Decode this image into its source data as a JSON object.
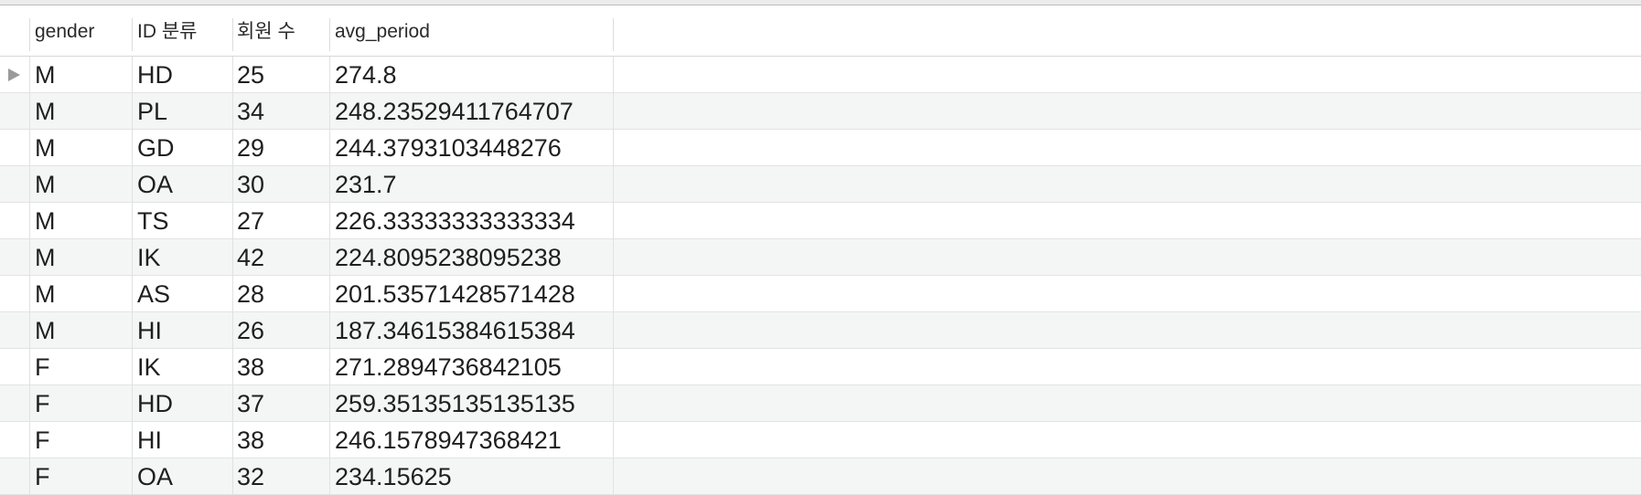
{
  "columns": {
    "gender": "gender",
    "id_category": "ID 분류",
    "member_count": "회원 수",
    "avg_period": "avg_period"
  },
  "rows": [
    {
      "gender": "M",
      "id_category": "HD",
      "member_count": "25",
      "avg_period": "274.8"
    },
    {
      "gender": "M",
      "id_category": "PL",
      "member_count": "34",
      "avg_period": "248.23529411764707"
    },
    {
      "gender": "M",
      "id_category": "GD",
      "member_count": "29",
      "avg_period": "244.3793103448276"
    },
    {
      "gender": "M",
      "id_category": "OA",
      "member_count": "30",
      "avg_period": "231.7"
    },
    {
      "gender": "M",
      "id_category": "TS",
      "member_count": "27",
      "avg_period": "226.33333333333334"
    },
    {
      "gender": "M",
      "id_category": "IK",
      "member_count": "42",
      "avg_period": "224.8095238095238"
    },
    {
      "gender": "M",
      "id_category": "AS",
      "member_count": "28",
      "avg_period": "201.53571428571428"
    },
    {
      "gender": "M",
      "id_category": "HI",
      "member_count": "26",
      "avg_period": "187.34615384615384"
    },
    {
      "gender": "F",
      "id_category": "IK",
      "member_count": "38",
      "avg_period": "271.2894736842105"
    },
    {
      "gender": "F",
      "id_category": "HD",
      "member_count": "37",
      "avg_period": "259.35135135135135"
    },
    {
      "gender": "F",
      "id_category": "HI",
      "member_count": "38",
      "avg_period": "246.1578947368421"
    },
    {
      "gender": "F",
      "id_category": "OA",
      "member_count": "32",
      "avg_period": "234.15625"
    }
  ],
  "current_row_index": 0,
  "icons": {
    "current_row_marker": "triangle-right-icon"
  },
  "colors": {
    "alt_row_background": "#f4f5f5",
    "grid_line": "#e3e3e3",
    "marker": "#9a9a9a"
  }
}
